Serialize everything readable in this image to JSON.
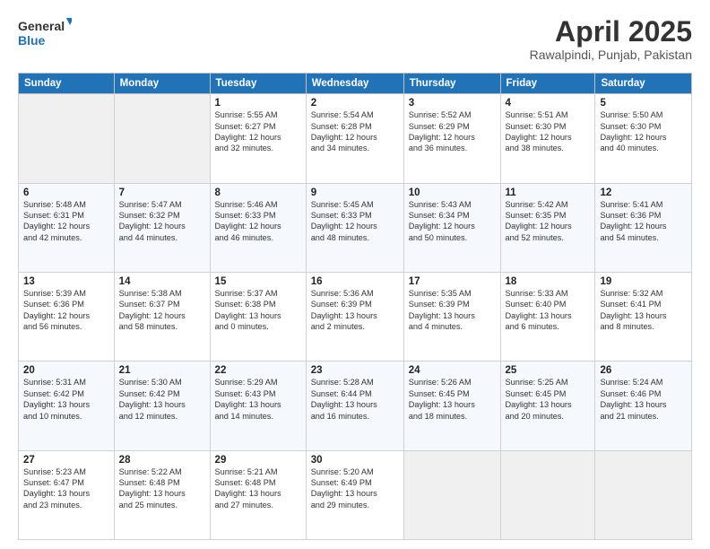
{
  "header": {
    "logo_line1": "General",
    "logo_line2": "Blue",
    "month": "April 2025",
    "location": "Rawalpindi, Punjab, Pakistan"
  },
  "days_of_week": [
    "Sunday",
    "Monday",
    "Tuesday",
    "Wednesday",
    "Thursday",
    "Friday",
    "Saturday"
  ],
  "weeks": [
    [
      {
        "day": "",
        "info": ""
      },
      {
        "day": "",
        "info": ""
      },
      {
        "day": "1",
        "info": "Sunrise: 5:55 AM\nSunset: 6:27 PM\nDaylight: 12 hours\nand 32 minutes."
      },
      {
        "day": "2",
        "info": "Sunrise: 5:54 AM\nSunset: 6:28 PM\nDaylight: 12 hours\nand 34 minutes."
      },
      {
        "day": "3",
        "info": "Sunrise: 5:52 AM\nSunset: 6:29 PM\nDaylight: 12 hours\nand 36 minutes."
      },
      {
        "day": "4",
        "info": "Sunrise: 5:51 AM\nSunset: 6:30 PM\nDaylight: 12 hours\nand 38 minutes."
      },
      {
        "day": "5",
        "info": "Sunrise: 5:50 AM\nSunset: 6:30 PM\nDaylight: 12 hours\nand 40 minutes."
      }
    ],
    [
      {
        "day": "6",
        "info": "Sunrise: 5:48 AM\nSunset: 6:31 PM\nDaylight: 12 hours\nand 42 minutes."
      },
      {
        "day": "7",
        "info": "Sunrise: 5:47 AM\nSunset: 6:32 PM\nDaylight: 12 hours\nand 44 minutes."
      },
      {
        "day": "8",
        "info": "Sunrise: 5:46 AM\nSunset: 6:33 PM\nDaylight: 12 hours\nand 46 minutes."
      },
      {
        "day": "9",
        "info": "Sunrise: 5:45 AM\nSunset: 6:33 PM\nDaylight: 12 hours\nand 48 minutes."
      },
      {
        "day": "10",
        "info": "Sunrise: 5:43 AM\nSunset: 6:34 PM\nDaylight: 12 hours\nand 50 minutes."
      },
      {
        "day": "11",
        "info": "Sunrise: 5:42 AM\nSunset: 6:35 PM\nDaylight: 12 hours\nand 52 minutes."
      },
      {
        "day": "12",
        "info": "Sunrise: 5:41 AM\nSunset: 6:36 PM\nDaylight: 12 hours\nand 54 minutes."
      }
    ],
    [
      {
        "day": "13",
        "info": "Sunrise: 5:39 AM\nSunset: 6:36 PM\nDaylight: 12 hours\nand 56 minutes."
      },
      {
        "day": "14",
        "info": "Sunrise: 5:38 AM\nSunset: 6:37 PM\nDaylight: 12 hours\nand 58 minutes."
      },
      {
        "day": "15",
        "info": "Sunrise: 5:37 AM\nSunset: 6:38 PM\nDaylight: 13 hours\nand 0 minutes."
      },
      {
        "day": "16",
        "info": "Sunrise: 5:36 AM\nSunset: 6:39 PM\nDaylight: 13 hours\nand 2 minutes."
      },
      {
        "day": "17",
        "info": "Sunrise: 5:35 AM\nSunset: 6:39 PM\nDaylight: 13 hours\nand 4 minutes."
      },
      {
        "day": "18",
        "info": "Sunrise: 5:33 AM\nSunset: 6:40 PM\nDaylight: 13 hours\nand 6 minutes."
      },
      {
        "day": "19",
        "info": "Sunrise: 5:32 AM\nSunset: 6:41 PM\nDaylight: 13 hours\nand 8 minutes."
      }
    ],
    [
      {
        "day": "20",
        "info": "Sunrise: 5:31 AM\nSunset: 6:42 PM\nDaylight: 13 hours\nand 10 minutes."
      },
      {
        "day": "21",
        "info": "Sunrise: 5:30 AM\nSunset: 6:42 PM\nDaylight: 13 hours\nand 12 minutes."
      },
      {
        "day": "22",
        "info": "Sunrise: 5:29 AM\nSunset: 6:43 PM\nDaylight: 13 hours\nand 14 minutes."
      },
      {
        "day": "23",
        "info": "Sunrise: 5:28 AM\nSunset: 6:44 PM\nDaylight: 13 hours\nand 16 minutes."
      },
      {
        "day": "24",
        "info": "Sunrise: 5:26 AM\nSunset: 6:45 PM\nDaylight: 13 hours\nand 18 minutes."
      },
      {
        "day": "25",
        "info": "Sunrise: 5:25 AM\nSunset: 6:45 PM\nDaylight: 13 hours\nand 20 minutes."
      },
      {
        "day": "26",
        "info": "Sunrise: 5:24 AM\nSunset: 6:46 PM\nDaylight: 13 hours\nand 21 minutes."
      }
    ],
    [
      {
        "day": "27",
        "info": "Sunrise: 5:23 AM\nSunset: 6:47 PM\nDaylight: 13 hours\nand 23 minutes."
      },
      {
        "day": "28",
        "info": "Sunrise: 5:22 AM\nSunset: 6:48 PM\nDaylight: 13 hours\nand 25 minutes."
      },
      {
        "day": "29",
        "info": "Sunrise: 5:21 AM\nSunset: 6:48 PM\nDaylight: 13 hours\nand 27 minutes."
      },
      {
        "day": "30",
        "info": "Sunrise: 5:20 AM\nSunset: 6:49 PM\nDaylight: 13 hours\nand 29 minutes."
      },
      {
        "day": "",
        "info": ""
      },
      {
        "day": "",
        "info": ""
      },
      {
        "day": "",
        "info": ""
      }
    ]
  ]
}
